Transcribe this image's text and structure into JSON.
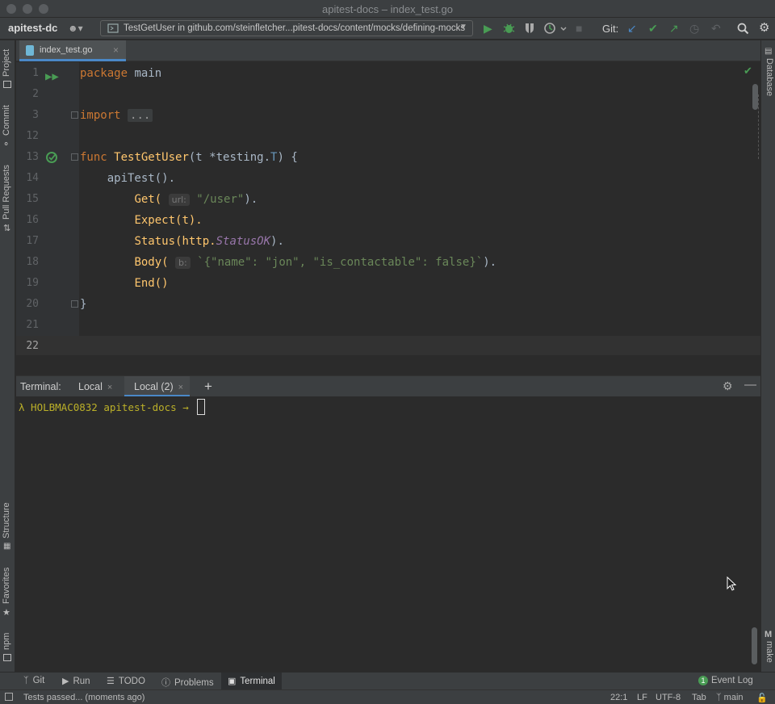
{
  "window": {
    "title": "apitest-docs – index_test.go"
  },
  "toolbar": {
    "project": "apitest-dc",
    "run_config": "TestGetUser in github.com/steinfletcher...pitest-docs/content/mocks/defining-mocks",
    "git_label": "Git:"
  },
  "left_tools": [
    "Project",
    "Commit",
    "Pull Requests",
    "Structure",
    "Favorites",
    "npm"
  ],
  "right_tools": [
    "Database",
    "make"
  ],
  "editor": {
    "tab": "index_test.go",
    "lines": [
      {
        "n": "1"
      },
      {
        "n": "2"
      },
      {
        "n": "3"
      },
      {
        "n": "12"
      },
      {
        "n": "13"
      },
      {
        "n": "14"
      },
      {
        "n": "15"
      },
      {
        "n": "16"
      },
      {
        "n": "17"
      },
      {
        "n": "18"
      },
      {
        "n": "19"
      },
      {
        "n": "20"
      },
      {
        "n": "21"
      },
      {
        "n": "22"
      }
    ],
    "code": {
      "package_kw": "package",
      "package_name": " main",
      "import_kw": "import",
      "import_fold": "...",
      "func_kw": "func",
      "func_name": "TestGetUser",
      "func_params_a": "(t *testing.",
      "func_params_T": "T",
      "func_params_b": ") {",
      "l14": "    apiTest().",
      "l15_fn": "Get(",
      "l15_hint": "url:",
      "l15_str": "\"/user\"",
      "l15_end": ").",
      "l16": "Expect(t).",
      "l17_a": "Status(http.",
      "l17_const": "StatusOK",
      "l17_b": ").",
      "l18_fn": "Body(",
      "l18_hint": "b:",
      "l18_str": "`{\"name\": \"jon\", \"is_contactable\": false}`",
      "l18_end": ").",
      "l19": "End()",
      "l20": "}"
    }
  },
  "terminal": {
    "label": "Terminal:",
    "tabs": [
      {
        "label": "Local",
        "close": "×"
      },
      {
        "label": "Local (2)",
        "close": "×"
      }
    ],
    "plus": "+",
    "prompt": "λ HOLBMAC0832 apitest-docs → "
  },
  "bottom_tools": {
    "git": "Git",
    "run": "Run",
    "todo": "TODO",
    "problems": "Problems",
    "terminal": "Terminal",
    "event_log": "Event Log",
    "event_count": "1"
  },
  "status": {
    "message": "Tests passed... (moments ago)",
    "position": "22:1",
    "line_sep": "LF",
    "encoding": "UTF-8",
    "indent": "Tab",
    "branch": "main"
  },
  "colors": {
    "keyword": "#cc7832",
    "function": "#ffc66d",
    "string": "#6a8759",
    "constant": "#9876aa",
    "accent": "#4a88c7",
    "run_green": "#499c54"
  }
}
